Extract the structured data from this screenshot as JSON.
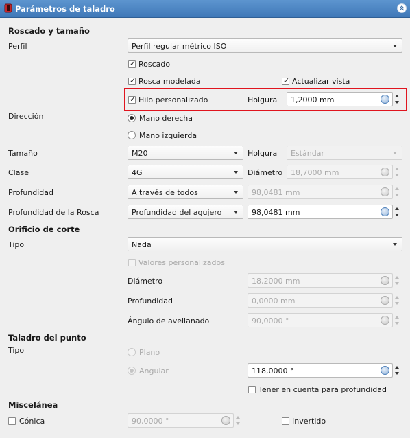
{
  "title": "Parámetros de taladro",
  "sections": {
    "threading": "Roscado y tamaño",
    "hole_cut": "Orificio de corte",
    "drill_point": "Taladro del punto",
    "misc": "Miscelánea"
  },
  "perfil": {
    "label": "Perfil",
    "value": "Perfil regular métrico ISO"
  },
  "roscado": {
    "label": "Roscado",
    "checked": true
  },
  "rosca_modelada": {
    "label": "Rosca modelada",
    "checked": true
  },
  "actualizar_vista": {
    "label": "Actualizar vista",
    "checked": true
  },
  "hilo_personalizado": {
    "label": "Hilo personalizado",
    "checked": true
  },
  "holgura_custom": {
    "label": "Holgura",
    "value": "1,2000 mm"
  },
  "direccion": {
    "label": "Dirección",
    "options": [
      "Mano derecha",
      "Mano izquierda"
    ],
    "selected": "Mano derecha"
  },
  "tamano": {
    "label": "Tamaño",
    "value": "M20"
  },
  "holgura": {
    "label": "Holgura",
    "value": "Estándar"
  },
  "clase": {
    "label": "Clase",
    "value": "4G"
  },
  "diametro_rosca": {
    "label": "Diámetro",
    "value": "18,7000 mm"
  },
  "profundidad": {
    "label": "Profundidad",
    "value": "A través de todos",
    "spin_value": "98,0481 mm"
  },
  "profundidad_rosca": {
    "label": "Profundidad de la Rosca",
    "value": "Profundidad del agujero",
    "spin_value": "98,0481 mm"
  },
  "orificio": {
    "tipo_label": "Tipo",
    "tipo_value": "Nada",
    "valores_personalizados": "Valores personalizados",
    "diametro_label": "Diámetro",
    "diametro_value": "18,2000 mm",
    "profundidad_label": "Profundidad",
    "profundidad_value": "0,0000 mm",
    "angulo_label": "Ángulo de avellanado",
    "angulo_value": "90,0000 °"
  },
  "punto": {
    "tipo_label": "Tipo",
    "plano": "Plano",
    "angular": "Angular",
    "angle_value": "118,0000 °",
    "tener_en_cuenta": "Tener en cuenta para profundidad"
  },
  "misc": {
    "conica": "Cónica",
    "conica_value": "90,0000 °",
    "invertido": "Invertido"
  },
  "colors": {
    "title_bar": "#4a85c4",
    "highlight": "#e0141e"
  }
}
